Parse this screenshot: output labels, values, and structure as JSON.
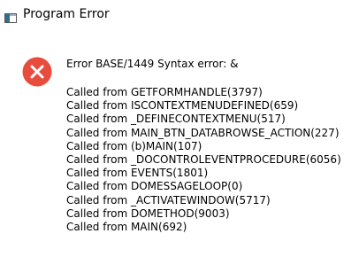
{
  "window": {
    "title": "Program Error",
    "app_icon": "window-app-icon"
  },
  "dialog": {
    "icon": "error-icon",
    "icon_color": "#e74c3c",
    "message": "Error BASE/1449  Syntax error: &",
    "stack_trace": [
      "Called from GETFORMHANDLE(3797)",
      "Called from ISCONTEXTMENUDEFINED(659)",
      "Called from _DEFINECONTEXTMENU(517)",
      "Called from MAIN_BTN_DATABROWSE_ACTION(227)",
      "Called from (b)MAIN(107)",
      "Called from _DOCONTROLEVENTPROCEDURE(6056)",
      "Called from EVENTS(1801)",
      "Called from DOMESSAGELOOP(0)",
      "Called from _ACTIVATEWINDOW(5717)",
      "Called from DOMETHOD(9003)",
      "Called from MAIN(692)"
    ]
  }
}
